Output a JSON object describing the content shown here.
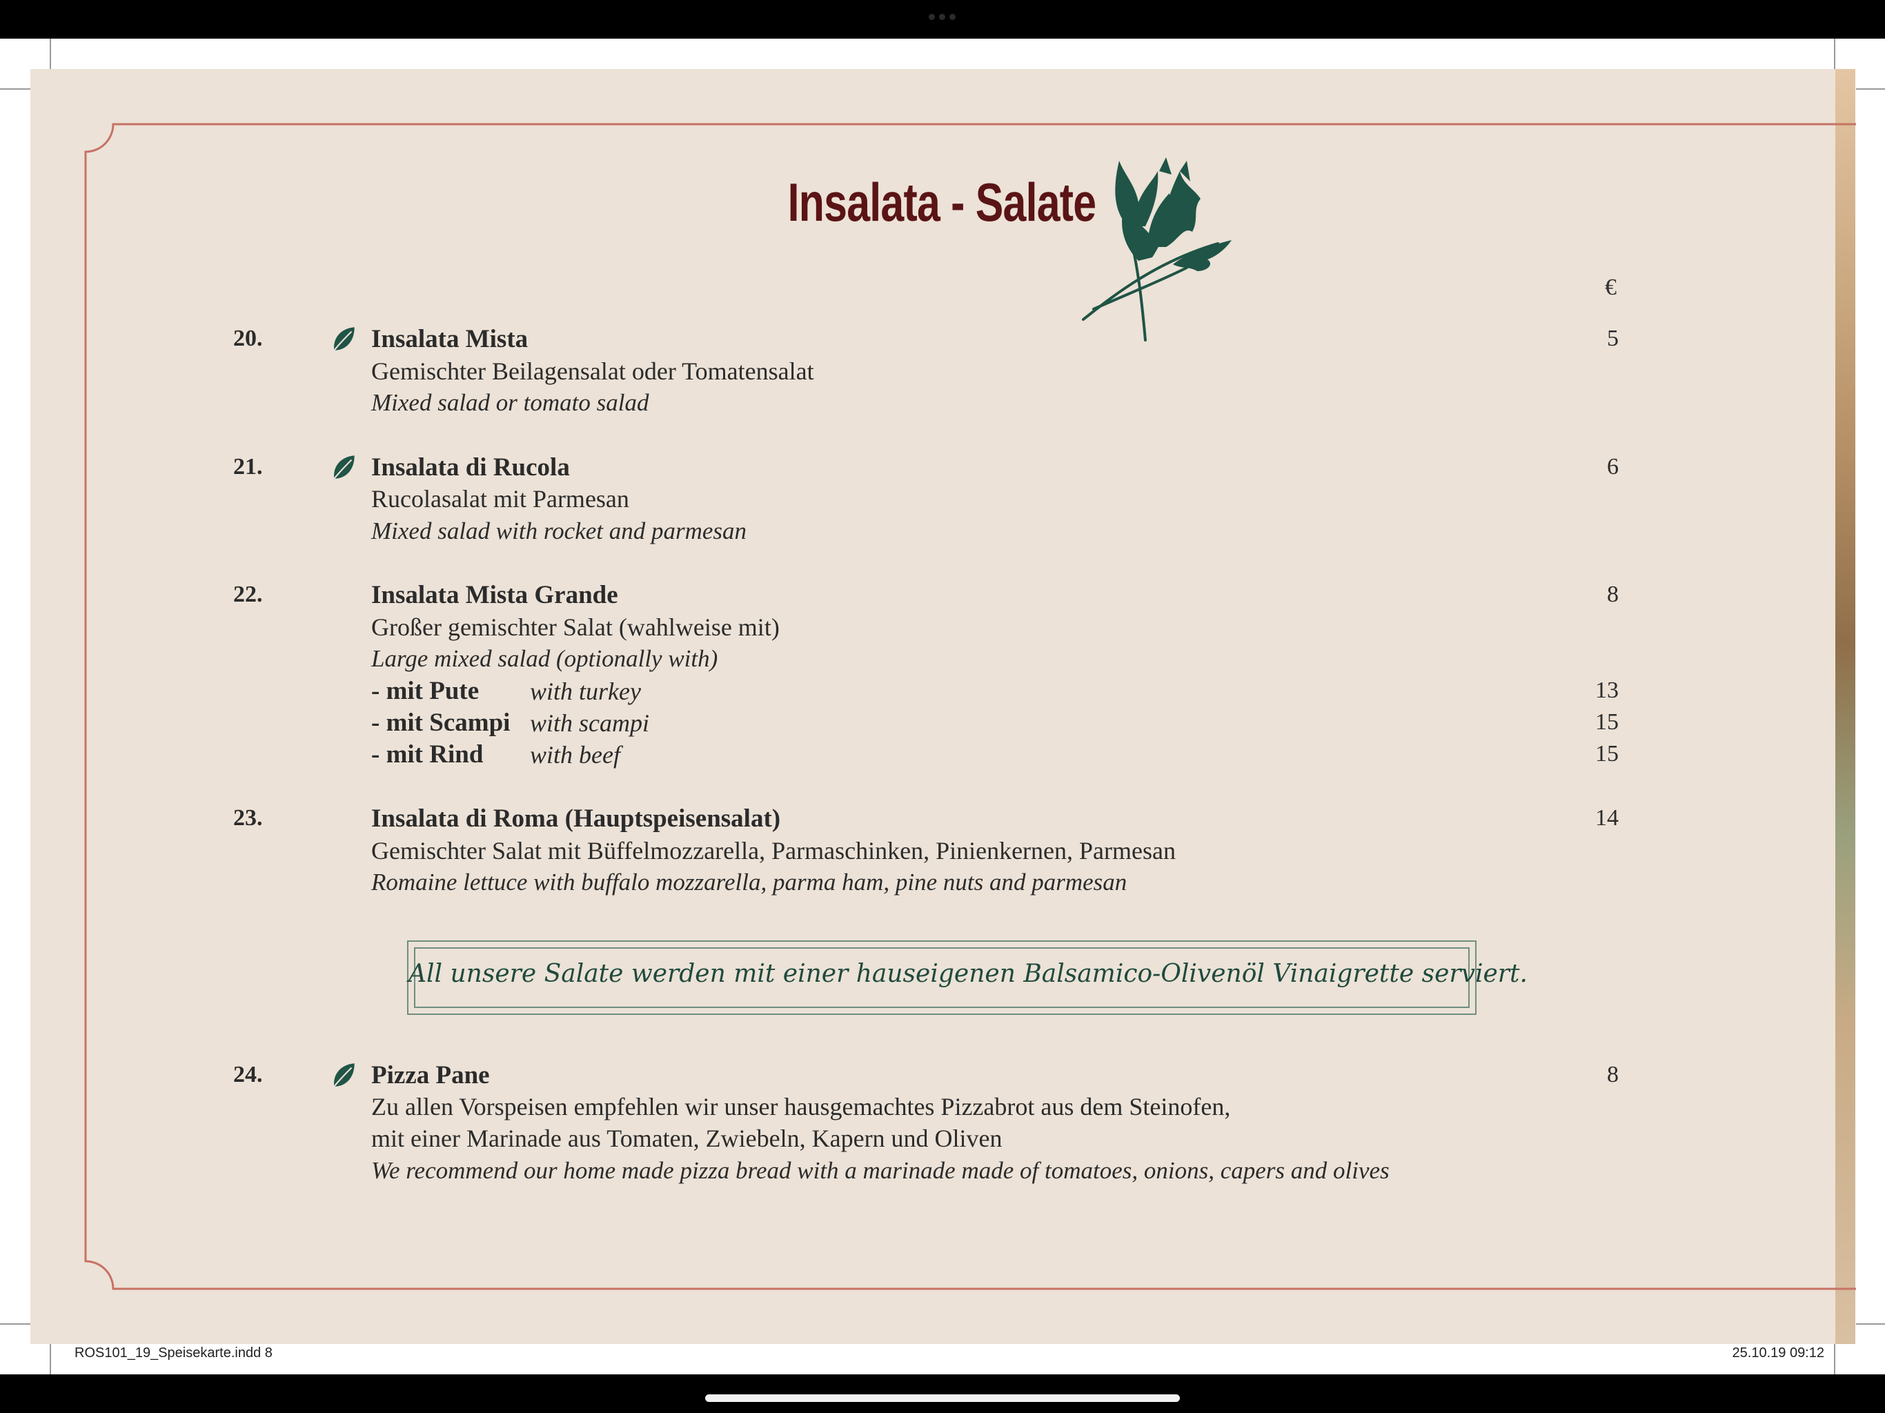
{
  "document": {
    "title": "Insalata - Salate",
    "currency": "€",
    "items": [
      {
        "number": "20.",
        "vegetarian": true,
        "name": "Insalata Mista",
        "description_de": "Gemischter Beilagensalat oder Tomatensalat",
        "description_en": "Mixed salad or tomato salad",
        "price": "5"
      },
      {
        "number": "21.",
        "vegetarian": true,
        "name": "Insalata di Rucola",
        "description_de": "Rucolasalat mit Parmesan",
        "description_en": "Mixed salad with rocket and parmesan",
        "price": "6"
      },
      {
        "number": "22.",
        "vegetarian": false,
        "name": "Insalata Mista Grande",
        "description_de": "Großer gemischter Salat (wahlweise mit)",
        "description_en": "Large mixed salad (optionally with)",
        "price": "8",
        "options": [
          {
            "label_de": "- mit Pute",
            "label_en": "with turkey",
            "price": "13"
          },
          {
            "label_de": "- mit Scampi",
            "label_en": "with scampi",
            "price": "15"
          },
          {
            "label_de": "- mit Rind",
            "label_en": "with beef",
            "price": "15"
          }
        ]
      },
      {
        "number": "23.",
        "vegetarian": false,
        "name": "Insalata di Roma (Hauptspeisensalat)",
        "description_de": "Gemischter Salat mit Büffelmozzarella, Parmaschinken, Pinienkernen, Parmesan",
        "description_en": "Romaine lettuce with buffalo mozzarella, parma ham, pine nuts and parmesan",
        "price": "14"
      },
      {
        "number": "24.",
        "vegetarian": true,
        "name": "Pizza Pane",
        "description_de": "Zu allen Vorspeisen empfehlen wir unser hausgemachtes Pizzabrot aus dem Steinofen,",
        "description_de_2": "mit einer Marinade aus Tomaten, Zwiebeln, Kapern und Oliven",
        "description_en": "We recommend our home made pizza bread with a marinade made of tomatoes, onions, capers and olives",
        "price": "8"
      }
    ],
    "note": "All unsere Salate werden mit einer hauseigenen Balsamico-Olivenöl Vinaigrette serviert."
  },
  "slug": {
    "file": "ROS101_19_Speisekarte.indd   8",
    "timestamp": "25.10.19   09:12"
  },
  "icons": {
    "vegetarian": "leaf-icon",
    "header_decoration": "arugula-icon"
  },
  "colors": {
    "page": "#ece2d7",
    "title": "#5a1416",
    "frame": "#c77265",
    "leaf": "#1f5446",
    "text": "#2b2b2b"
  }
}
